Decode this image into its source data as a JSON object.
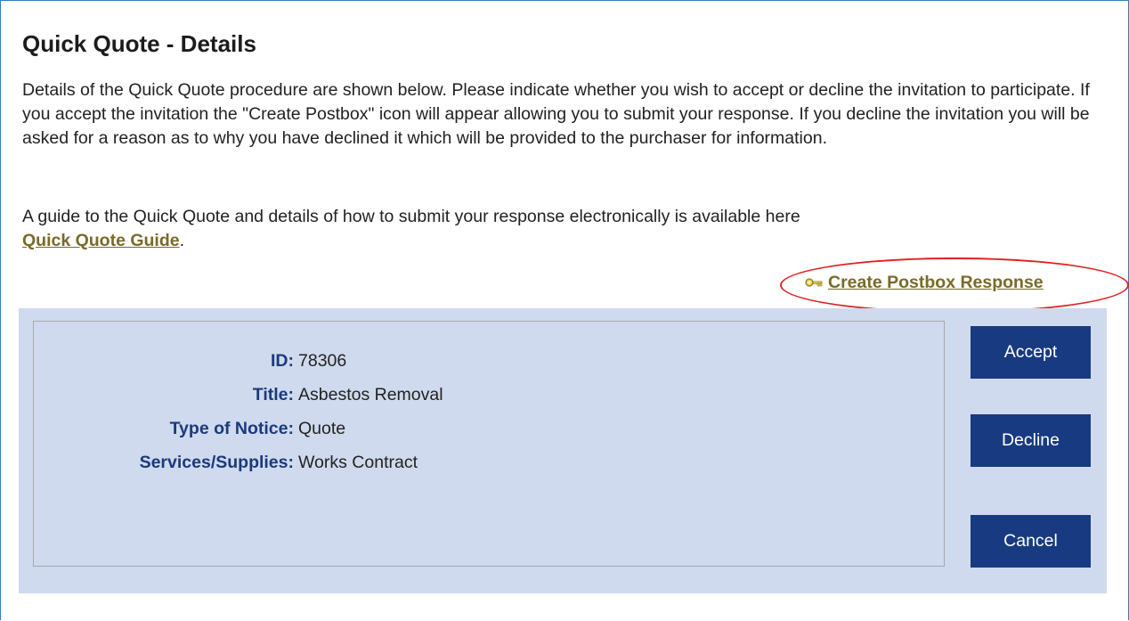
{
  "page": {
    "title": "Quick Quote - Details",
    "intro": "Details of the Quick Quote procedure are shown below. Please indicate whether you wish to accept or decline the invitation to participate. If you accept the invitation the \"Create Postbox\" icon will appear allowing you to submit your response. If you decline the invitation you will be asked for a reason as to why you have declined it which will be provided to the purchaser for information.",
    "guide_text": "A guide to the Quick Quote and details of how to submit your response electronically is available here",
    "guide_link": "Quick Quote Guide",
    "guide_suffix": "."
  },
  "postbox": {
    "label": "Create Postbox Response",
    "icon": "key-icon"
  },
  "details": {
    "id_label": "ID:",
    "id_value": "78306",
    "title_label": "Title:",
    "title_value": "Asbestos Removal",
    "notice_label": "Type of Notice:",
    "notice_value": "Quote",
    "services_label": "Services/Supplies:",
    "services_value": "Works Contract"
  },
  "buttons": {
    "accept": "Accept",
    "decline": "Decline",
    "cancel": "Cancel"
  },
  "colors": {
    "panel_bg": "#cfdaee",
    "button_bg": "#183a80",
    "label_text": "#1b3a7a",
    "link_text": "#7a6a2a",
    "highlight": "#e02020"
  }
}
